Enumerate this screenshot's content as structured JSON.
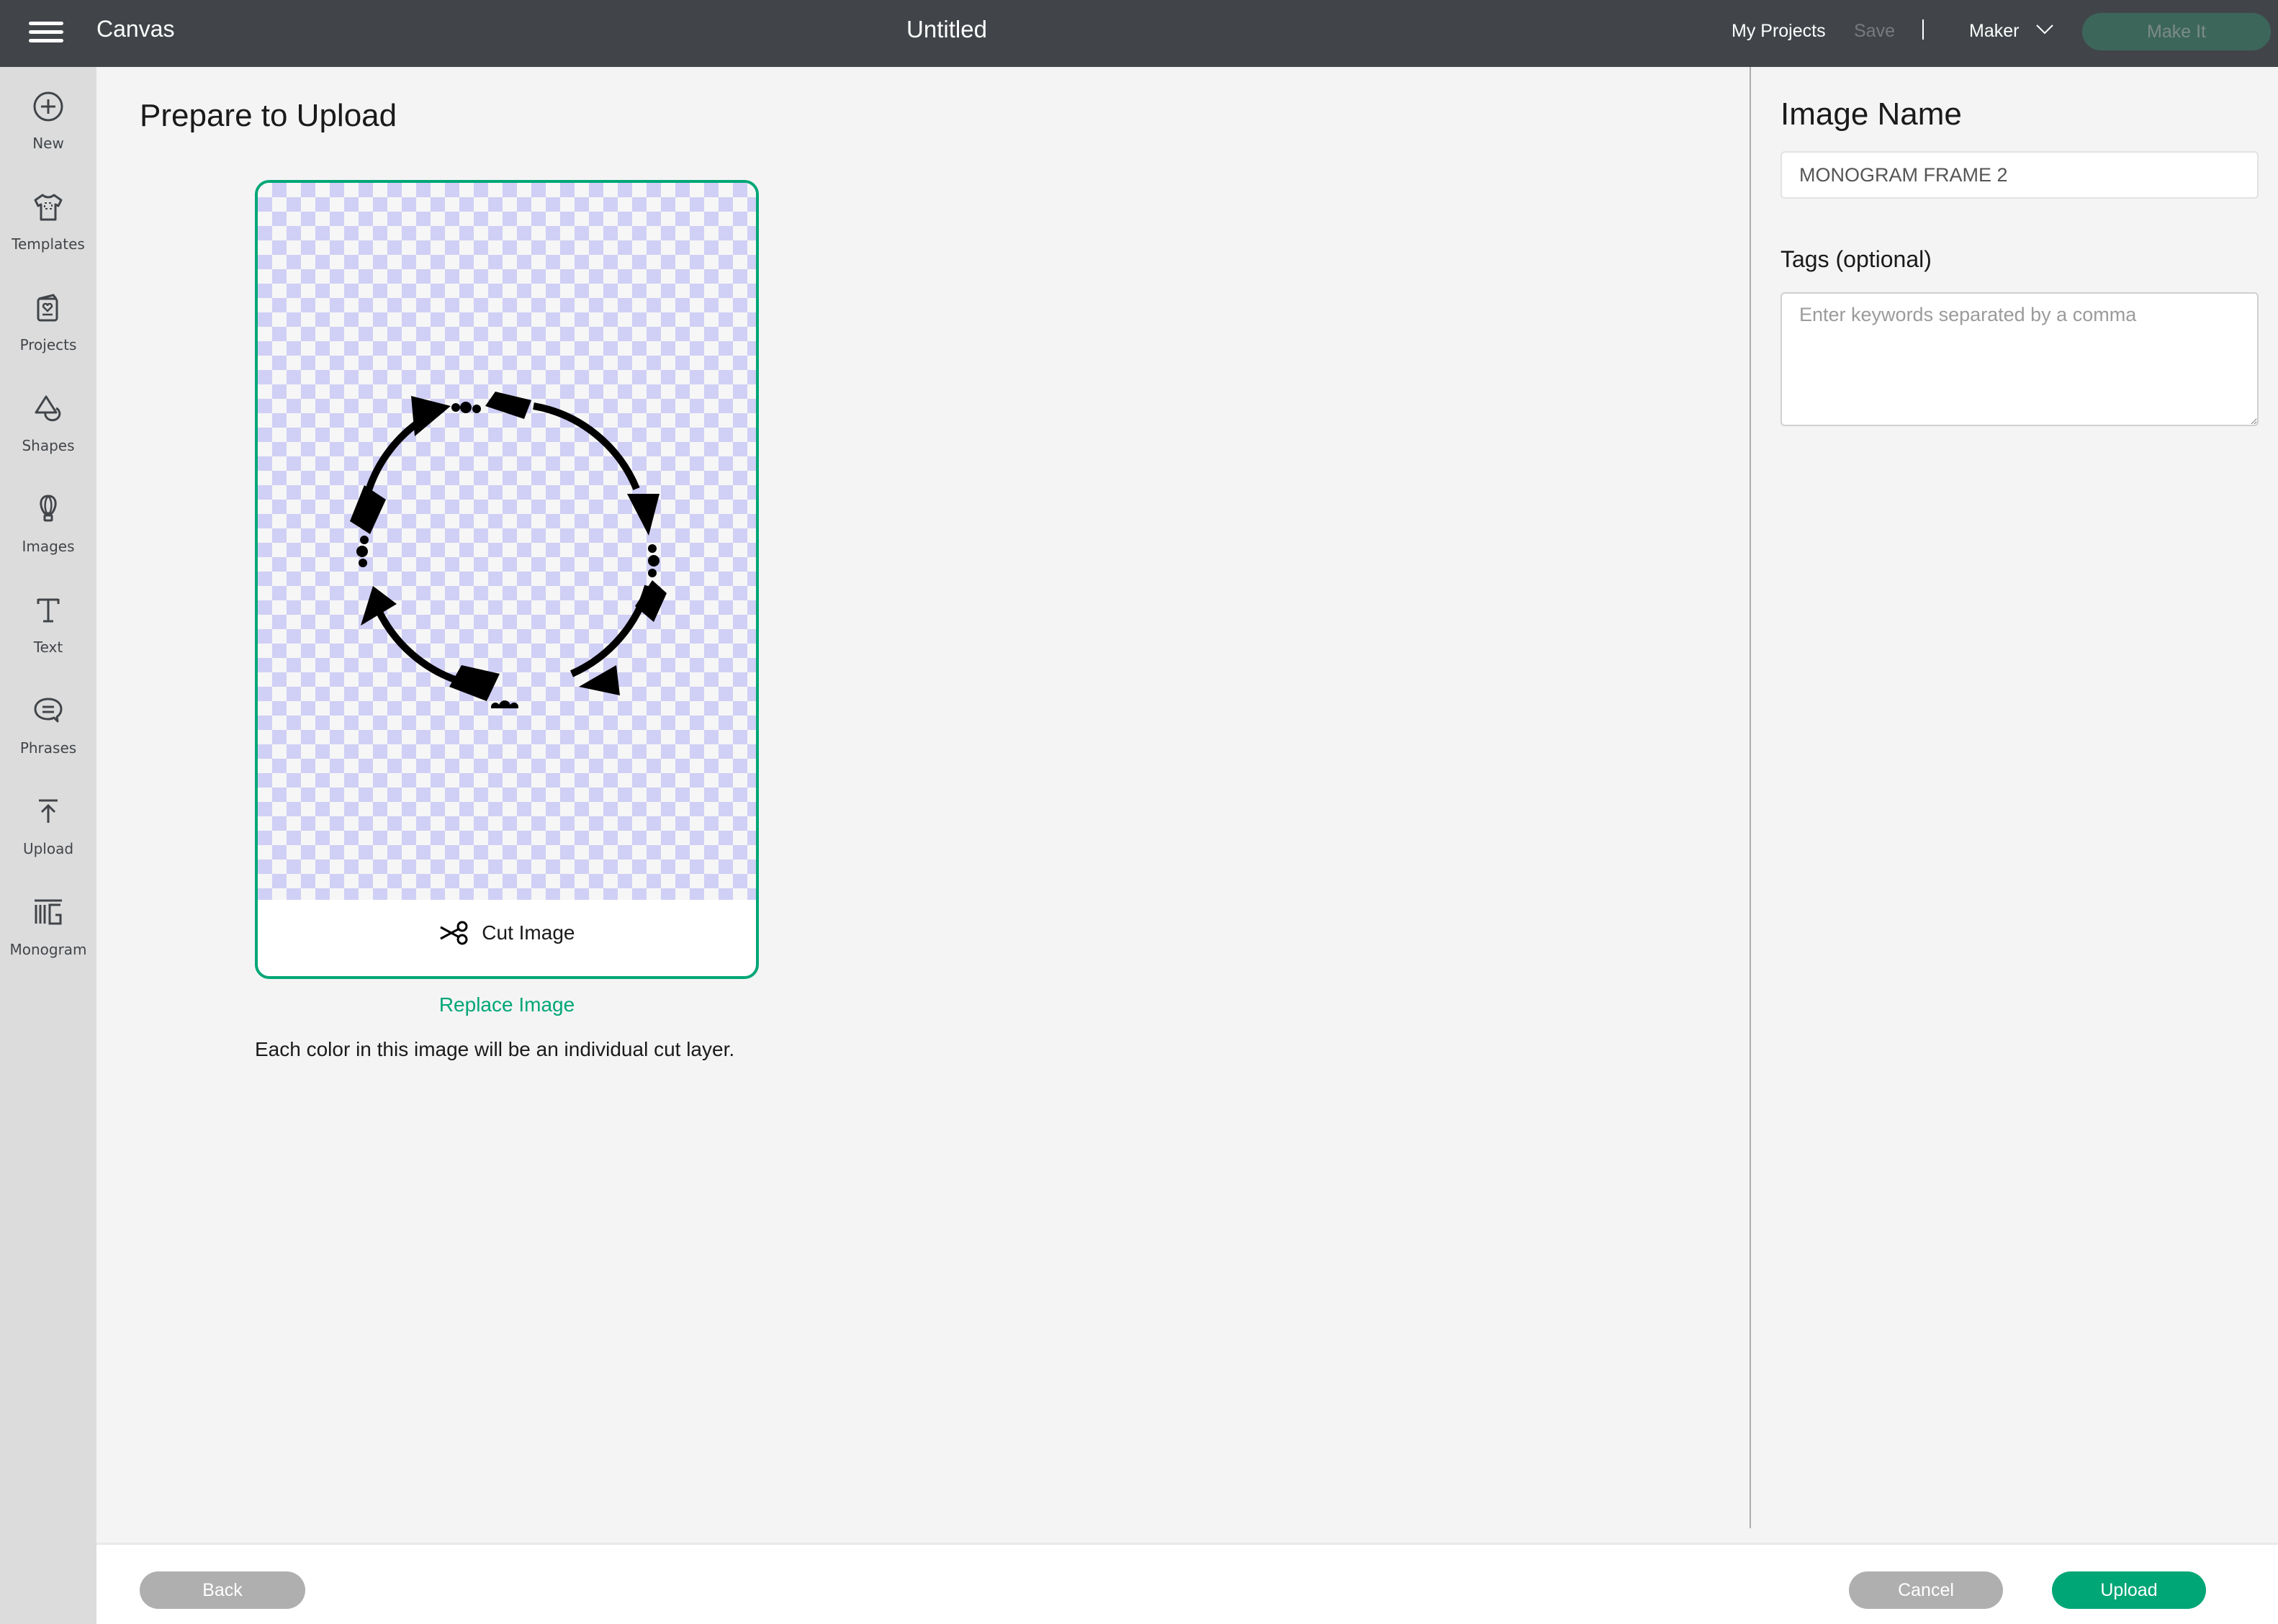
{
  "topbar": {
    "app_name": "Canvas",
    "doc_title": "Untitled",
    "my_projects": "My Projects",
    "save": "Save",
    "separator": "|",
    "machine": "Maker",
    "make_it": "Make It"
  },
  "sidebar": {
    "items": [
      {
        "label": "New",
        "icon": "plus-circle-icon"
      },
      {
        "label": "Templates",
        "icon": "tshirt-icon"
      },
      {
        "label": "Projects",
        "icon": "card-heart-icon"
      },
      {
        "label": "Shapes",
        "icon": "shapes-icon"
      },
      {
        "label": "Images",
        "icon": "balloon-icon"
      },
      {
        "label": "Text",
        "icon": "text-icon"
      },
      {
        "label": "Phrases",
        "icon": "speech-bubble-icon"
      },
      {
        "label": "Upload",
        "icon": "upload-icon"
      },
      {
        "label": "Monogram",
        "icon": "monogram-icon"
      }
    ]
  },
  "main": {
    "title": "Prepare to Upload",
    "cut_label": "Cut Image",
    "replace_label": "Replace Image",
    "note": "Each color in this image will be an individual cut layer."
  },
  "panel": {
    "title": "Image Name",
    "name_value": "MONOGRAM FRAME 2",
    "tags_label": "Tags (optional)",
    "tags_placeholder": "Enter keywords separated by a comma",
    "tags_value": ""
  },
  "footer": {
    "back": "Back",
    "cancel": "Cancel",
    "upload": "Upload"
  },
  "colors": {
    "accent": "#00a676",
    "topbar": "#414549",
    "sidebar": "#dcdcdc",
    "make_it": "#3d665b",
    "disabled_button": "#afafaf"
  }
}
